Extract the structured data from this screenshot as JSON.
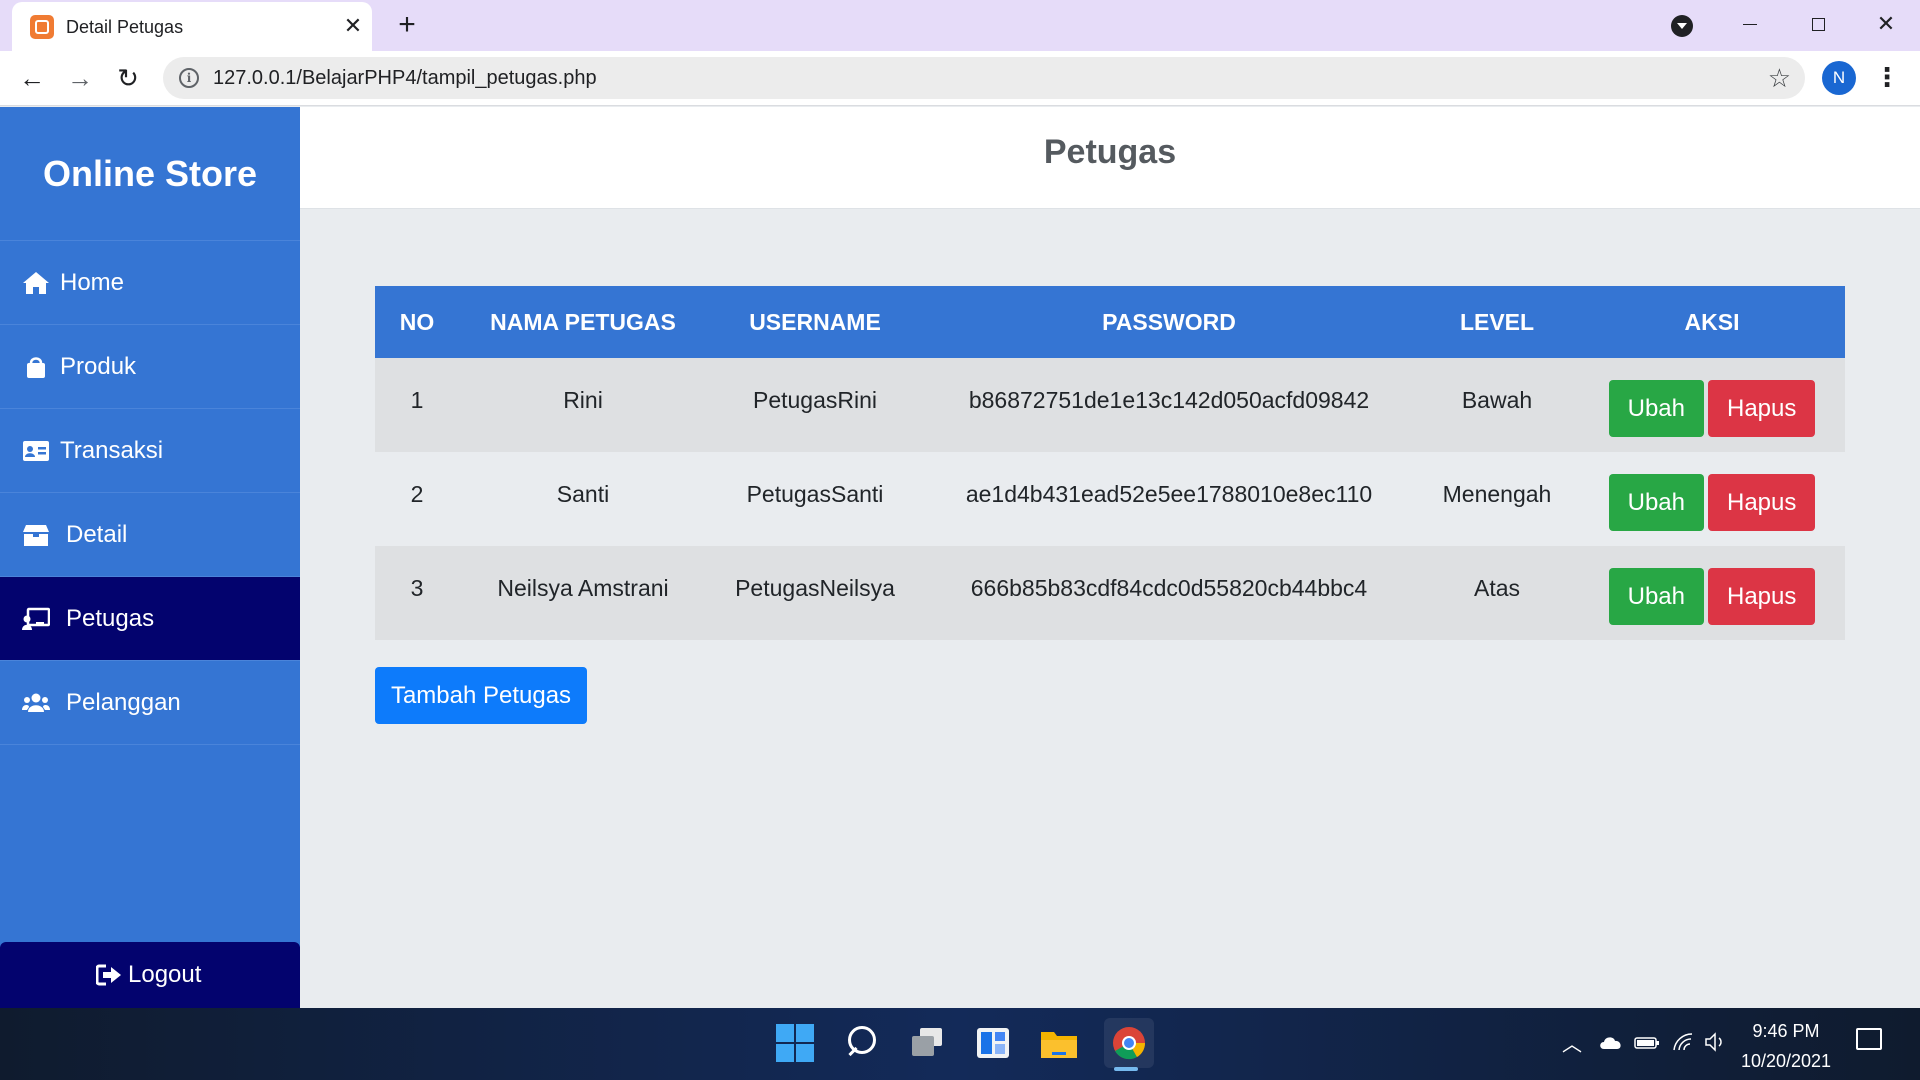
{
  "browser": {
    "tab_title": "Detail Petugas",
    "tab_close": "✕",
    "new_tab": "+",
    "url": "127.0.0.1/BelajarPHP4/tampil_petugas.php",
    "profile_initial": "N",
    "icons": [
      "xampp-favicon-icon",
      "back-arrow-icon",
      "forward-arrow-icon",
      "reload-icon",
      "info-icon",
      "star-icon",
      "menu-dots-icon"
    ]
  },
  "sidebar": {
    "brand": "Online Store",
    "items": [
      {
        "label": "Home",
        "icon": "home-icon"
      },
      {
        "label": "Produk",
        "icon": "shopping-bag-icon"
      },
      {
        "label": "Transaksi",
        "icon": "id-card-icon"
      },
      {
        "label": "Detail",
        "icon": "box-icon"
      },
      {
        "label": "Petugas",
        "icon": "chalkboard-teacher-icon",
        "active": true
      },
      {
        "label": "Pelanggan",
        "icon": "users-icon"
      }
    ],
    "logout": "Logout"
  },
  "main": {
    "title": "Petugas",
    "table": {
      "headers": [
        "NO",
        "NAMA PETUGAS",
        "USERNAME",
        "PASSWORD",
        "LEVEL",
        "AKSI"
      ],
      "rows": [
        {
          "no": "1",
          "nama": "Rini",
          "username": "PetugasRini",
          "password": "b86872751de1e13c142d050acfd09842",
          "level": "Bawah"
        },
        {
          "no": "2",
          "nama": "Santi",
          "username": "PetugasSanti",
          "password": "ae1d4b431ead52e5ee1788010e8ec110",
          "level": "Menengah"
        },
        {
          "no": "3",
          "nama": "Neilsya Amstrani",
          "username": "PetugasNeilsya",
          "password": "666b85b83cdf84cdc0d55820cb44bbc4",
          "level": "Atas"
        }
      ],
      "ubah_label": "Ubah",
      "hapus_label": "Hapus"
    },
    "add_button": "Tambah Petugas"
  },
  "taskbar": {
    "time": "9:46 PM",
    "date": "10/20/2021"
  },
  "colors": {
    "sidebar": "#3575d3",
    "sidebar_active": "#03036e",
    "ubah": "#28a745",
    "hapus": "#dc3545",
    "primary": "#0d7bfb"
  }
}
